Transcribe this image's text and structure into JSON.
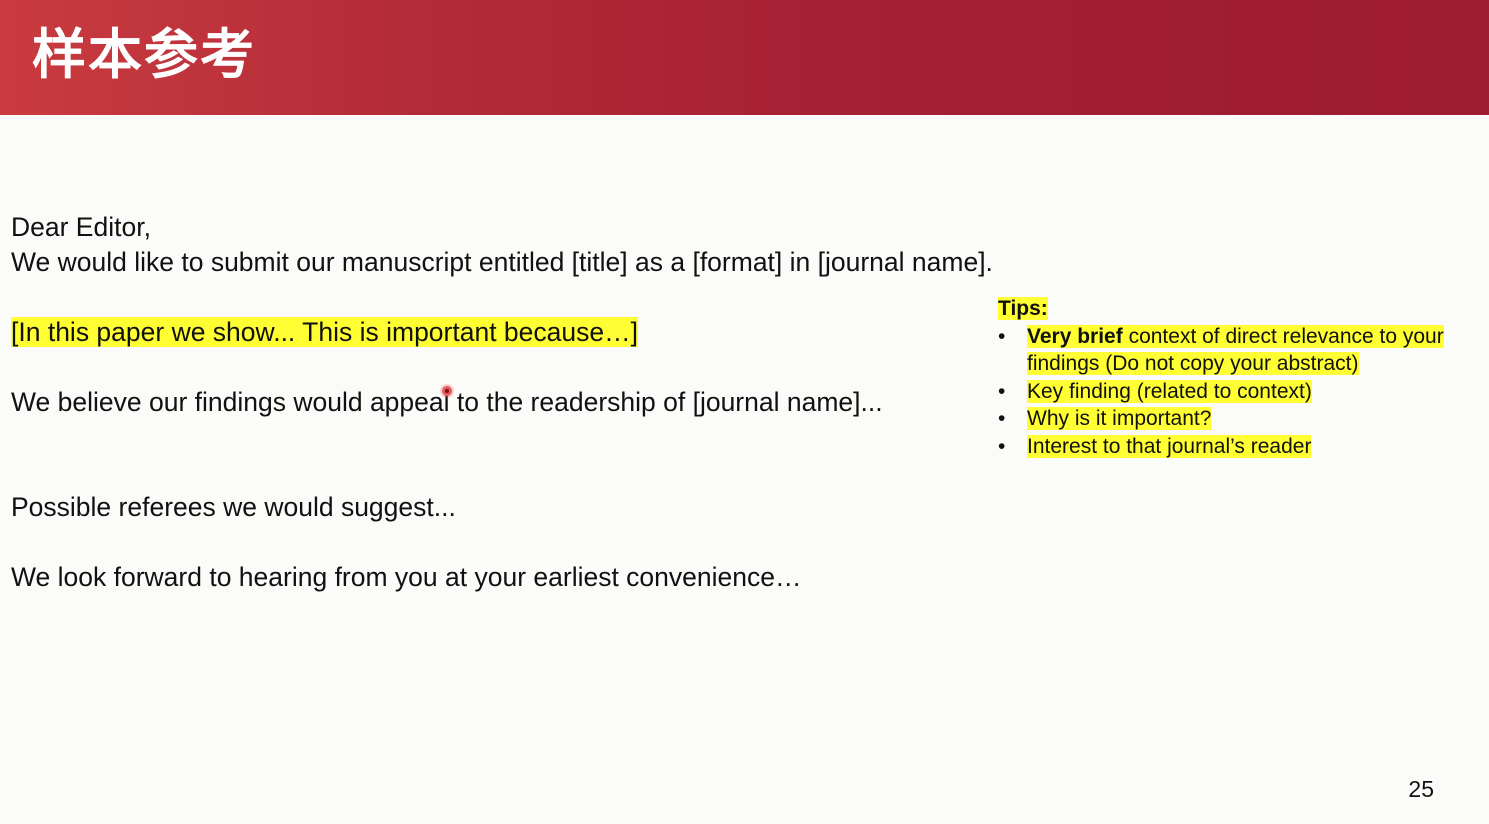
{
  "header": {
    "title": "样本参考",
    "background_color": "#a31f33"
  },
  "letter": {
    "salutation": "Dear Editor,",
    "intro": "We would like to submit our manuscript entitled [title] as a [format] in [journal name].",
    "highlight_paragraph": "[In this paper we show... This is  important because…]",
    "appeal_paragraph": "We believe our findings would appeal to the readership of [journal name]...",
    "referees_paragraph": "Possible referees we would suggest...",
    "closing_paragraph": "We look forward to hearing from you at your earliest convenience…"
  },
  "tips": {
    "heading": "Tips:",
    "bullet_glyph": "•",
    "items": [
      {
        "bold": "Very brief",
        "rest": " context of direct relevance to your findings  (Do not copy your abstract)"
      },
      {
        "bold": "",
        "rest": "Key finding (related to context)"
      },
      {
        "bold": "",
        "rest": "Why is it important?"
      },
      {
        "bold": "",
        "rest": "Interest to that journal’s reader"
      }
    ],
    "highlight_color": "#ffff33"
  },
  "footer": {
    "page_number": "25"
  }
}
